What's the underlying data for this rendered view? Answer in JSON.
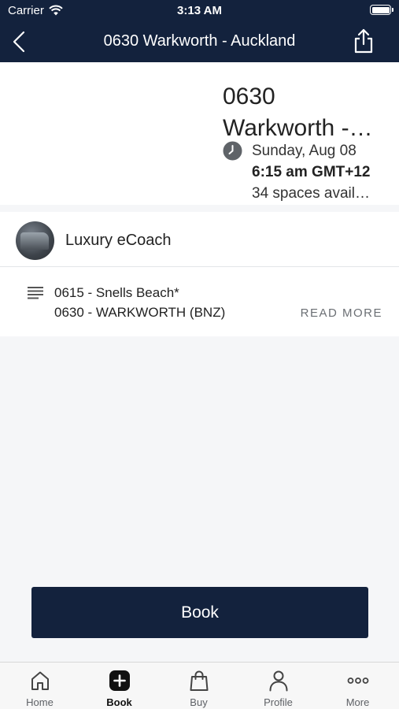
{
  "status_bar": {
    "carrier": "Carrier",
    "time": "3:13 AM"
  },
  "nav": {
    "title": "0630 Warkworth - Auckland"
  },
  "trip": {
    "title_line1": "0630",
    "title_line2": "Warkworth -…",
    "date": "Sunday, Aug 08",
    "departure": "6:15 am GMT+12",
    "spaces": "34 spaces avail…"
  },
  "vehicle": {
    "name": "Luxury eCoach"
  },
  "stops": {
    "first": "0615 - Snells Beach*",
    "second": "0630 - WARKWORTH (BNZ)",
    "read_more": "READ MORE"
  },
  "book_button": {
    "label": "Book"
  },
  "tabs": [
    {
      "label": "Home",
      "icon": "home-icon",
      "active": false
    },
    {
      "label": "Book",
      "icon": "plus-square-icon",
      "active": true
    },
    {
      "label": "Buy",
      "icon": "shopping-bag-icon",
      "active": false
    },
    {
      "label": "Profile",
      "icon": "person-icon",
      "active": false
    },
    {
      "label": "More",
      "icon": "more-dots-icon",
      "active": false
    }
  ],
  "colors": {
    "primary": "#13223d",
    "background": "#f5f6f8"
  }
}
